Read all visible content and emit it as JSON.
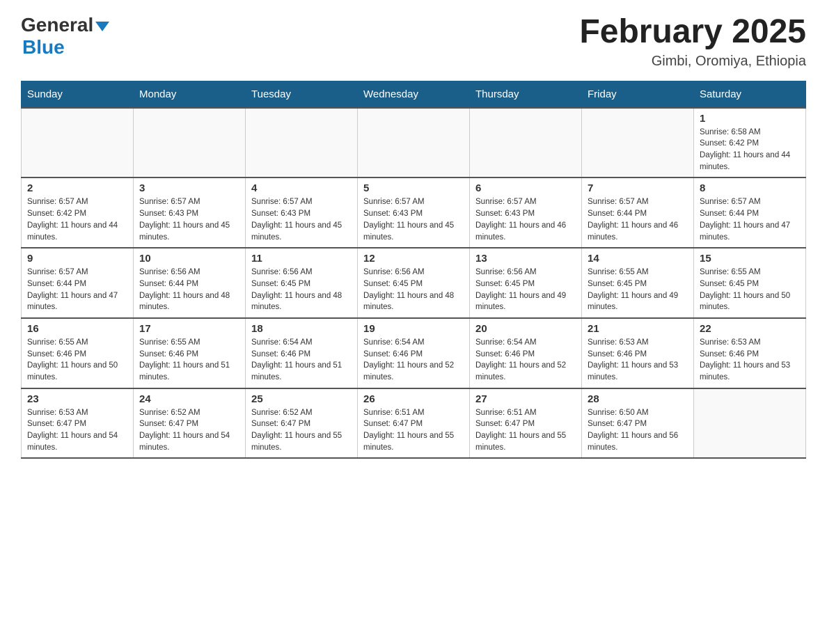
{
  "header": {
    "logo_general": "General",
    "logo_blue": "Blue",
    "month_title": "February 2025",
    "location": "Gimbi, Oromiya, Ethiopia"
  },
  "weekdays": [
    "Sunday",
    "Monday",
    "Tuesday",
    "Wednesday",
    "Thursday",
    "Friday",
    "Saturday"
  ],
  "weeks": [
    [
      {
        "day": "",
        "sunrise": "",
        "sunset": "",
        "daylight": ""
      },
      {
        "day": "",
        "sunrise": "",
        "sunset": "",
        "daylight": ""
      },
      {
        "day": "",
        "sunrise": "",
        "sunset": "",
        "daylight": ""
      },
      {
        "day": "",
        "sunrise": "",
        "sunset": "",
        "daylight": ""
      },
      {
        "day": "",
        "sunrise": "",
        "sunset": "",
        "daylight": ""
      },
      {
        "day": "",
        "sunrise": "",
        "sunset": "",
        "daylight": ""
      },
      {
        "day": "1",
        "sunrise": "Sunrise: 6:58 AM",
        "sunset": "Sunset: 6:42 PM",
        "daylight": "Daylight: 11 hours and 44 minutes."
      }
    ],
    [
      {
        "day": "2",
        "sunrise": "Sunrise: 6:57 AM",
        "sunset": "Sunset: 6:42 PM",
        "daylight": "Daylight: 11 hours and 44 minutes."
      },
      {
        "day": "3",
        "sunrise": "Sunrise: 6:57 AM",
        "sunset": "Sunset: 6:43 PM",
        "daylight": "Daylight: 11 hours and 45 minutes."
      },
      {
        "day": "4",
        "sunrise": "Sunrise: 6:57 AM",
        "sunset": "Sunset: 6:43 PM",
        "daylight": "Daylight: 11 hours and 45 minutes."
      },
      {
        "day": "5",
        "sunrise": "Sunrise: 6:57 AM",
        "sunset": "Sunset: 6:43 PM",
        "daylight": "Daylight: 11 hours and 45 minutes."
      },
      {
        "day": "6",
        "sunrise": "Sunrise: 6:57 AM",
        "sunset": "Sunset: 6:43 PM",
        "daylight": "Daylight: 11 hours and 46 minutes."
      },
      {
        "day": "7",
        "sunrise": "Sunrise: 6:57 AM",
        "sunset": "Sunset: 6:44 PM",
        "daylight": "Daylight: 11 hours and 46 minutes."
      },
      {
        "day": "8",
        "sunrise": "Sunrise: 6:57 AM",
        "sunset": "Sunset: 6:44 PM",
        "daylight": "Daylight: 11 hours and 47 minutes."
      }
    ],
    [
      {
        "day": "9",
        "sunrise": "Sunrise: 6:57 AM",
        "sunset": "Sunset: 6:44 PM",
        "daylight": "Daylight: 11 hours and 47 minutes."
      },
      {
        "day": "10",
        "sunrise": "Sunrise: 6:56 AM",
        "sunset": "Sunset: 6:44 PM",
        "daylight": "Daylight: 11 hours and 48 minutes."
      },
      {
        "day": "11",
        "sunrise": "Sunrise: 6:56 AM",
        "sunset": "Sunset: 6:45 PM",
        "daylight": "Daylight: 11 hours and 48 minutes."
      },
      {
        "day": "12",
        "sunrise": "Sunrise: 6:56 AM",
        "sunset": "Sunset: 6:45 PM",
        "daylight": "Daylight: 11 hours and 48 minutes."
      },
      {
        "day": "13",
        "sunrise": "Sunrise: 6:56 AM",
        "sunset": "Sunset: 6:45 PM",
        "daylight": "Daylight: 11 hours and 49 minutes."
      },
      {
        "day": "14",
        "sunrise": "Sunrise: 6:55 AM",
        "sunset": "Sunset: 6:45 PM",
        "daylight": "Daylight: 11 hours and 49 minutes."
      },
      {
        "day": "15",
        "sunrise": "Sunrise: 6:55 AM",
        "sunset": "Sunset: 6:45 PM",
        "daylight": "Daylight: 11 hours and 50 minutes."
      }
    ],
    [
      {
        "day": "16",
        "sunrise": "Sunrise: 6:55 AM",
        "sunset": "Sunset: 6:46 PM",
        "daylight": "Daylight: 11 hours and 50 minutes."
      },
      {
        "day": "17",
        "sunrise": "Sunrise: 6:55 AM",
        "sunset": "Sunset: 6:46 PM",
        "daylight": "Daylight: 11 hours and 51 minutes."
      },
      {
        "day": "18",
        "sunrise": "Sunrise: 6:54 AM",
        "sunset": "Sunset: 6:46 PM",
        "daylight": "Daylight: 11 hours and 51 minutes."
      },
      {
        "day": "19",
        "sunrise": "Sunrise: 6:54 AM",
        "sunset": "Sunset: 6:46 PM",
        "daylight": "Daylight: 11 hours and 52 minutes."
      },
      {
        "day": "20",
        "sunrise": "Sunrise: 6:54 AM",
        "sunset": "Sunset: 6:46 PM",
        "daylight": "Daylight: 11 hours and 52 minutes."
      },
      {
        "day": "21",
        "sunrise": "Sunrise: 6:53 AM",
        "sunset": "Sunset: 6:46 PM",
        "daylight": "Daylight: 11 hours and 53 minutes."
      },
      {
        "day": "22",
        "sunrise": "Sunrise: 6:53 AM",
        "sunset": "Sunset: 6:46 PM",
        "daylight": "Daylight: 11 hours and 53 minutes."
      }
    ],
    [
      {
        "day": "23",
        "sunrise": "Sunrise: 6:53 AM",
        "sunset": "Sunset: 6:47 PM",
        "daylight": "Daylight: 11 hours and 54 minutes."
      },
      {
        "day": "24",
        "sunrise": "Sunrise: 6:52 AM",
        "sunset": "Sunset: 6:47 PM",
        "daylight": "Daylight: 11 hours and 54 minutes."
      },
      {
        "day": "25",
        "sunrise": "Sunrise: 6:52 AM",
        "sunset": "Sunset: 6:47 PM",
        "daylight": "Daylight: 11 hours and 55 minutes."
      },
      {
        "day": "26",
        "sunrise": "Sunrise: 6:51 AM",
        "sunset": "Sunset: 6:47 PM",
        "daylight": "Daylight: 11 hours and 55 minutes."
      },
      {
        "day": "27",
        "sunrise": "Sunrise: 6:51 AM",
        "sunset": "Sunset: 6:47 PM",
        "daylight": "Daylight: 11 hours and 55 minutes."
      },
      {
        "day": "28",
        "sunrise": "Sunrise: 6:50 AM",
        "sunset": "Sunset: 6:47 PM",
        "daylight": "Daylight: 11 hours and 56 minutes."
      },
      {
        "day": "",
        "sunrise": "",
        "sunset": "",
        "daylight": ""
      }
    ]
  ]
}
